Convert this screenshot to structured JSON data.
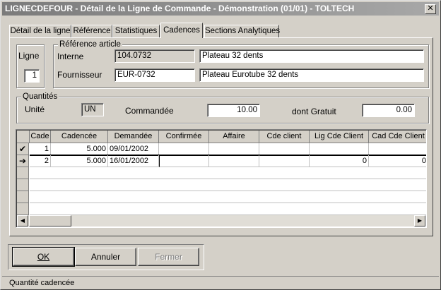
{
  "window": {
    "title": "LIGNECDEFOUR - Détail de la Ligne de Commande - Démonstration (01/01) - TOLTECH",
    "close_glyph": "✕"
  },
  "tabs": [
    {
      "label": "Détail de la ligne"
    },
    {
      "label": "Référence"
    },
    {
      "label": "Statistiques"
    },
    {
      "label": "Cadences"
    },
    {
      "label": "Sections Analytiques"
    }
  ],
  "active_tab": "Cadences",
  "ligne": {
    "label": "Ligne",
    "value": "1"
  },
  "reference_article": {
    "group_label": "Référence article",
    "interne_label": "Interne",
    "interne_code": "104.0732",
    "interne_desc": "Plateau 32 dents",
    "fournisseur_label": "Fournisseur",
    "fournisseur_code": "EUR-0732",
    "fournisseur_desc": "Plateau Eurotube 32 dents"
  },
  "quantites": {
    "group_label": "Quantités",
    "unite_label": "Unité",
    "unite_value": "UN",
    "commandee_label": "Commandée",
    "commandee_value": "10.00",
    "gratuit_label": "dont Gratuit",
    "gratuit_value": "0.00"
  },
  "grid": {
    "columns": [
      "Cade",
      "Cadencée",
      "Demandée",
      "Confirmée",
      "Affaire",
      "Cde client",
      "Lig Cde Client",
      "Cad Cde Client"
    ],
    "rows": [
      {
        "indicator": "✔",
        "cells": [
          "1",
          "5.000",
          "09/01/2002",
          "",
          "",
          "",
          "",
          ""
        ]
      },
      {
        "indicator": "➔",
        "cells": [
          "2",
          "5.000",
          "16/01/2002",
          "",
          "",
          "",
          "0",
          "0"
        ]
      }
    ],
    "scroll_left": "◀",
    "scroll_right": "▶"
  },
  "buttons": {
    "ok": "OK",
    "annuler": "Annuler",
    "fermer": "Fermer"
  },
  "status": "Quantité cadencée"
}
